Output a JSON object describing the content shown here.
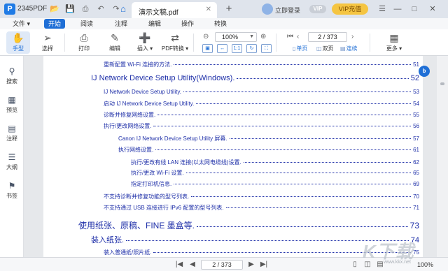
{
  "window": {
    "app_name": "2345PDF",
    "tab_title": "演示文稿.pdf",
    "login_label": "立即登录",
    "vip_badge": "VIP",
    "vip_button": "VIP充值"
  },
  "menu": {
    "file": "文件",
    "items": [
      "开始",
      "阅读",
      "注释",
      "编辑",
      "操作",
      "转换"
    ]
  },
  "toolbar": {
    "hand": "手型",
    "select": "选择",
    "print": "打印",
    "edit": "编辑",
    "insert": "插入",
    "pdf_convert": "PDF转换",
    "zoom": "100%",
    "page_indicator": "2 / 373",
    "single": "单页",
    "double": "双页",
    "continuous": "连续",
    "more": "更多"
  },
  "sidebar": {
    "items": [
      "搜索",
      "预览",
      "注释",
      "大纲",
      "书签"
    ]
  },
  "toc": [
    {
      "text": "重新配置 Wi-Fi 连接的方法.",
      "page": "51"
    },
    {
      "text": "IJ Network Device Setup Utility(Windows).",
      "page": "52"
    },
    {
      "text": "IJ Network Device Setup Utility.",
      "page": "53"
    },
    {
      "text": "启动 IJ Network Device Setup Utility.",
      "page": "54"
    },
    {
      "text": "诊断并修复网络设置.",
      "page": "55"
    },
    {
      "text": "执行/更改网络设置.",
      "page": "56"
    },
    {
      "text": "Canon IJ Network Device Setup Utility 屏幕.",
      "page": "57"
    },
    {
      "text": "执行网络设置.",
      "page": "61"
    },
    {
      "text": "执行/更改有线 LAN 连接(以太网电缆线)设置.",
      "page": "62"
    },
    {
      "text": "执行/更改 Wi-Fi 设置.",
      "page": "65"
    },
    {
      "text": "指定打印机信息.",
      "page": "69"
    },
    {
      "text": "不支持诊断并修复功能的型号列表.",
      "page": "70"
    },
    {
      "text": "不支持通过 USB 连接进行 IPv6 配置的型号列表.",
      "page": "71"
    },
    {
      "text": "使用纸张、原稿、FINE 墨盒等.",
      "page": "73"
    },
    {
      "text": "装入纸张.",
      "page": "74"
    },
    {
      "text": "装入普通纸/照片纸.",
      "page": "75"
    }
  ],
  "status": {
    "page_indicator": "2 / 373",
    "zoom": "100%"
  },
  "watermark": {
    "main": "K下载",
    "sub": "www.kkx.net"
  },
  "colors": {
    "accent": "#1f6fd6",
    "toc_link": "#1e2fa8",
    "vip": "#f5c542"
  }
}
